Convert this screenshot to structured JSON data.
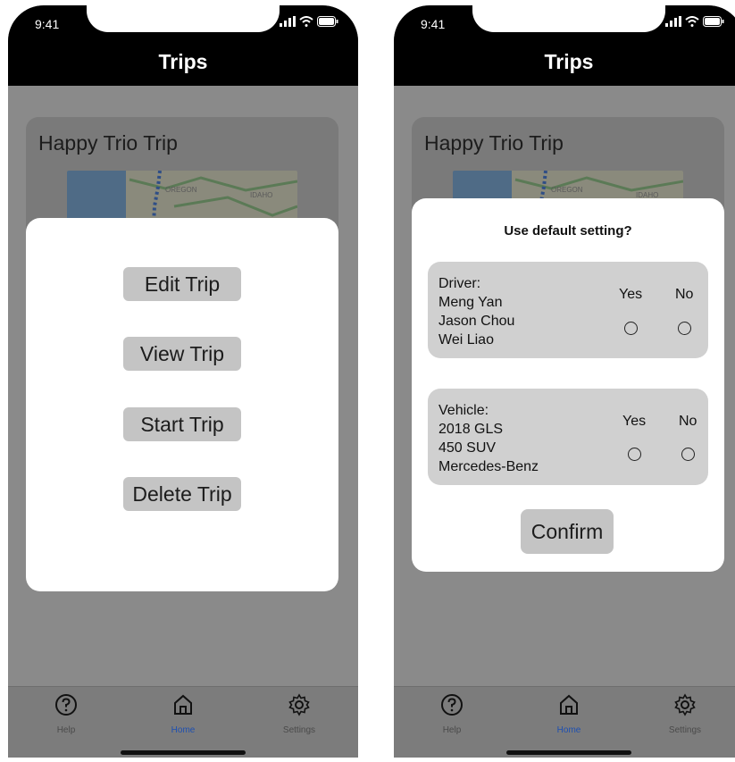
{
  "status_bar": {
    "time": "9:41"
  },
  "header": {
    "title": "Trips"
  },
  "trip": {
    "name": "Happy Trio Trip",
    "map_labels": [
      "OREGON",
      "IDAHO"
    ]
  },
  "actions": [
    "Edit Trip",
    "View Trip",
    "Start Trip",
    "Delete Trip"
  ],
  "dialog": {
    "title": "Use default setting?",
    "driver": {
      "heading": "Driver:",
      "lines": [
        "Meng Yan",
        "Jason Chou",
        "Wei Liao"
      ]
    },
    "vehicle": {
      "heading": "Vehicle:",
      "lines": [
        "2018 GLS",
        "450 SUV",
        "Mercedes-Benz"
      ]
    },
    "yes_label": "Yes",
    "no_label": "No",
    "confirm_label": "Confirm"
  },
  "tabbar": {
    "items": [
      {
        "label": "Help",
        "icon": "help-icon"
      },
      {
        "label": "Home",
        "icon": "home-icon",
        "active": true
      },
      {
        "label": "Settings",
        "icon": "gear-icon"
      }
    ]
  },
  "colors": {
    "active_tab": "#1e4fb0",
    "header_bg": "#000000",
    "dim_bg": "#8a8a8a",
    "button_bg": "#c4c4c4"
  }
}
